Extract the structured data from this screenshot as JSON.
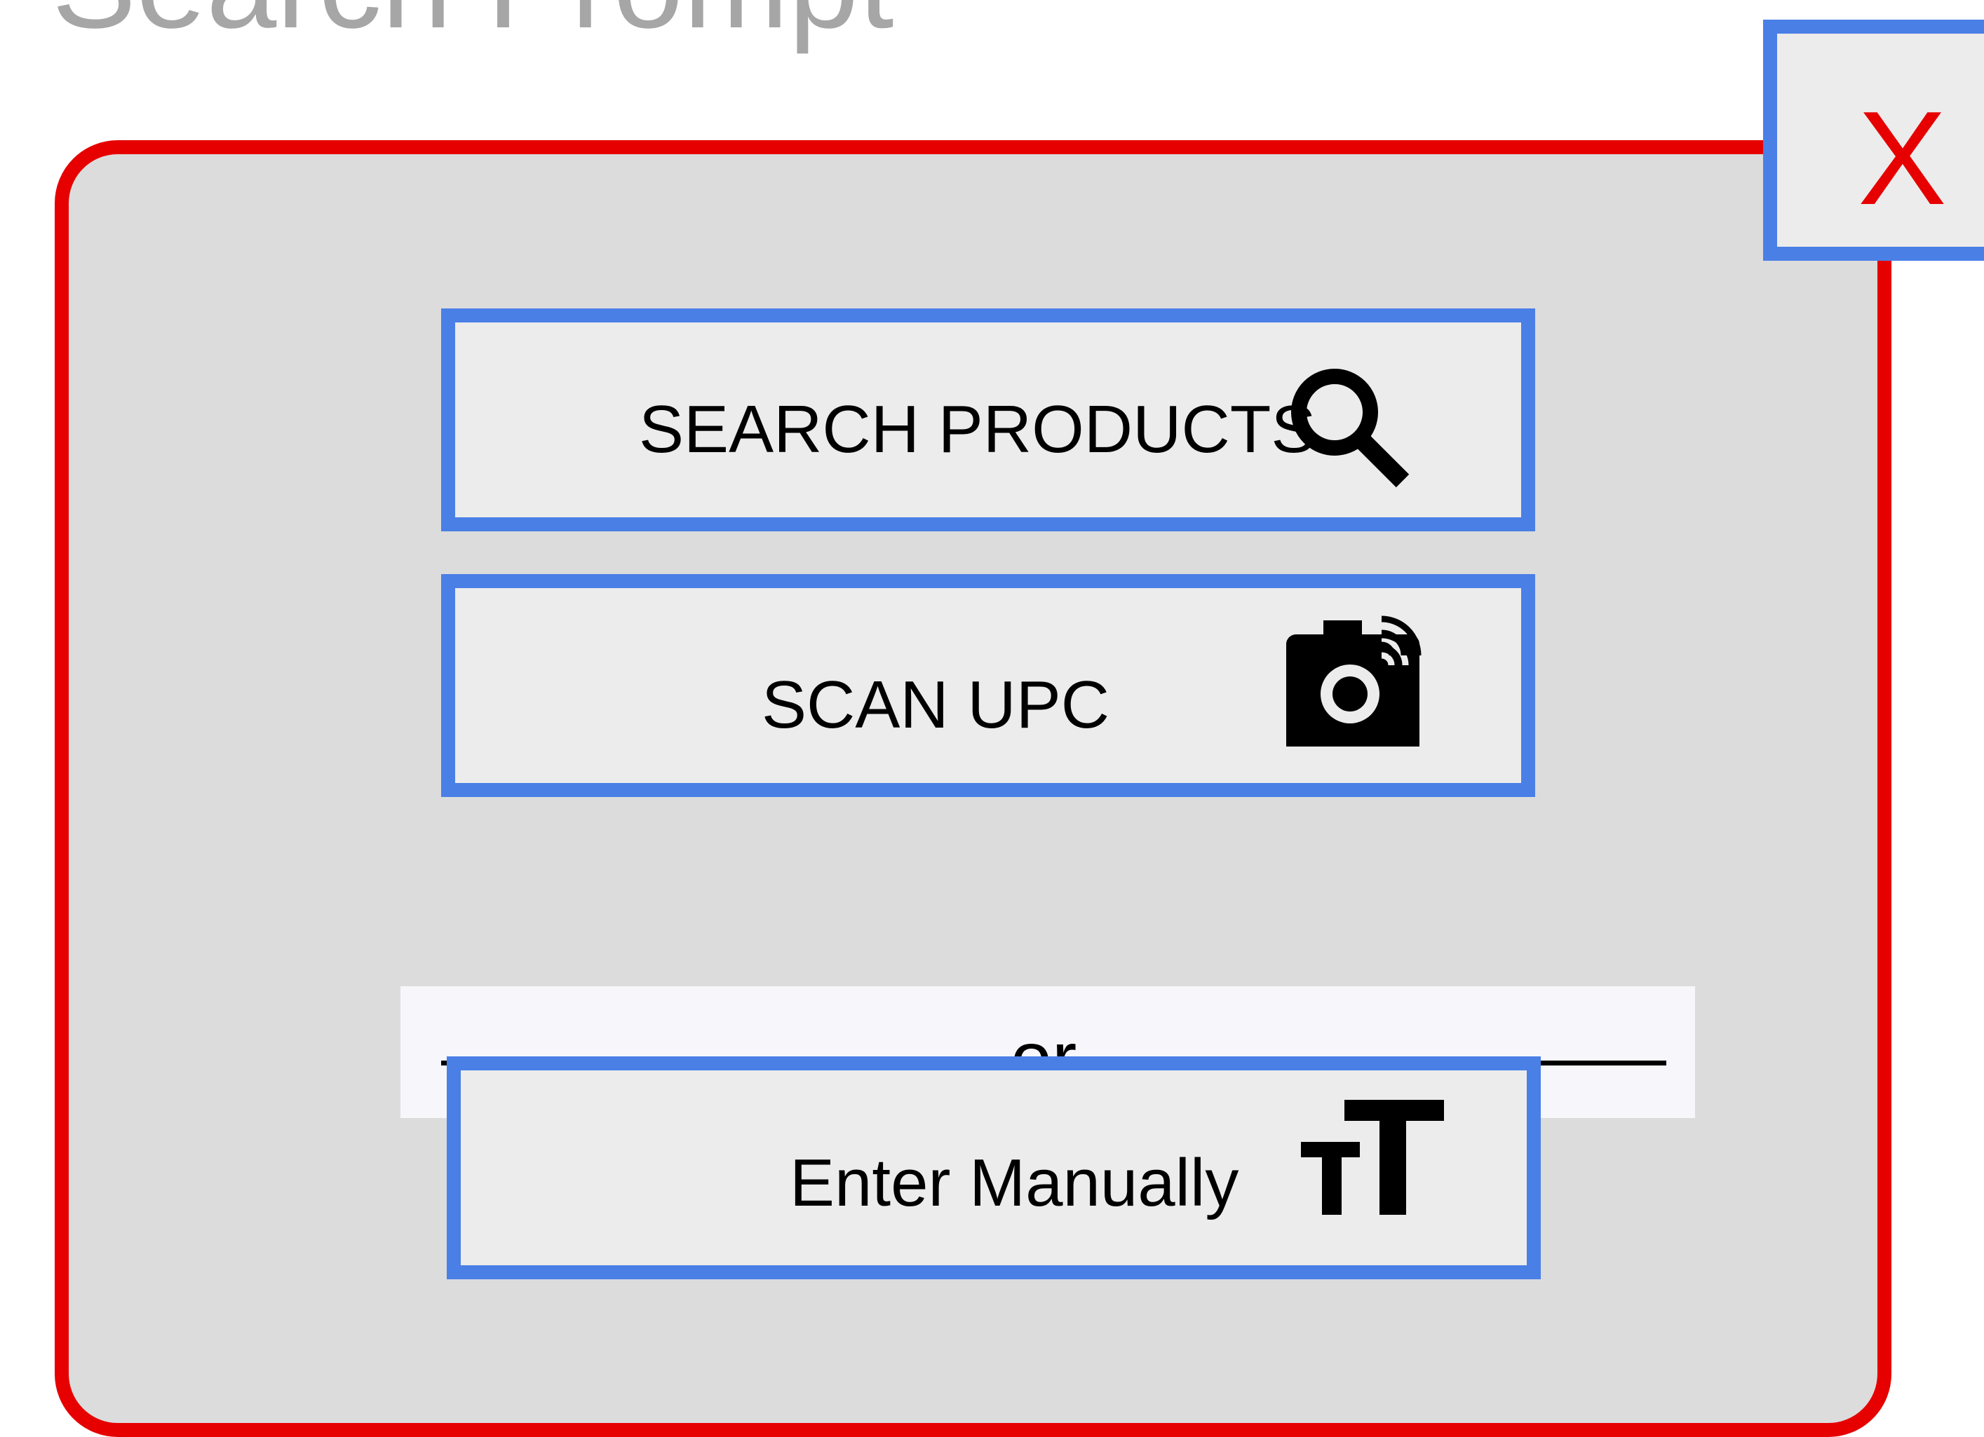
{
  "page": {
    "title": "Search Prompt"
  },
  "dialog": {
    "close_label": "X",
    "search_products": {
      "label": "SEARCH PRODUCTS",
      "icon": "search-icon"
    },
    "scan_upc": {
      "label": "SCAN UPC",
      "icon": "camera-icon"
    },
    "divider": {
      "label": "or"
    },
    "enter_manually": {
      "label": "Enter Manually",
      "icon": "text-size-icon"
    }
  },
  "colors": {
    "dialog_border": "#e60000",
    "dialog_background": "#dcdcdc",
    "button_border": "#4a7fe6",
    "button_background": "#ececec",
    "title_text": "#a6a6a6",
    "close_x": "#e60000"
  }
}
